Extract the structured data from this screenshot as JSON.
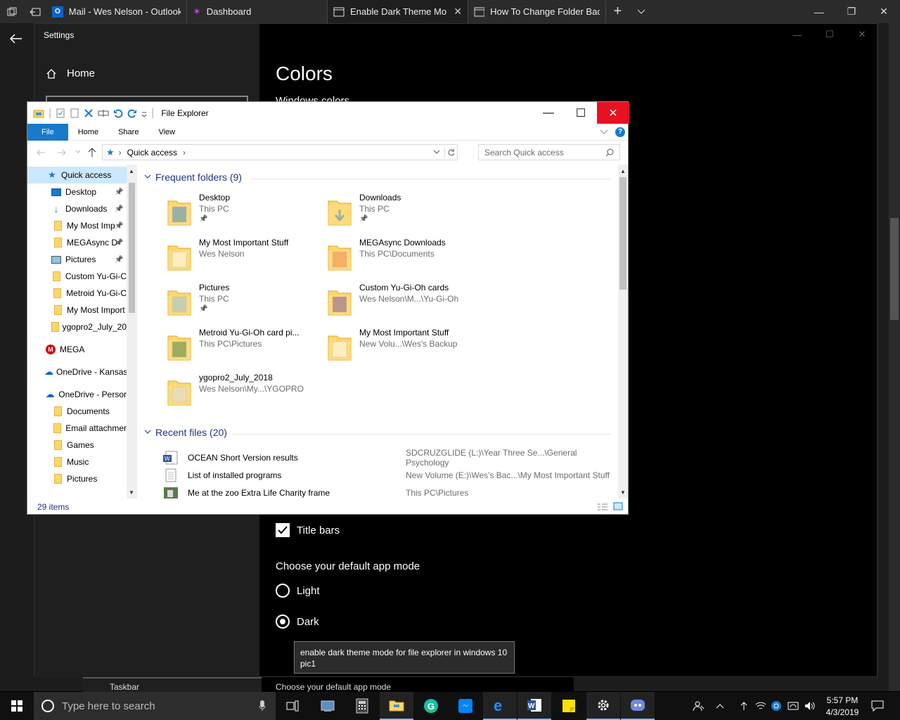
{
  "browser": {
    "tabs": [
      {
        "title": "Mail - Wes Nelson - Outlook"
      },
      {
        "title": "Dashboard"
      },
      {
        "title": "Enable Dark Theme Mo"
      },
      {
        "title": "How To Change Folder Back"
      }
    ]
  },
  "settings": {
    "window_title": "Settings",
    "home_label": "Home",
    "heading": "Colors",
    "subheading": "Windows colors",
    "title_bars_label": "Title bars",
    "app_mode_label": "Choose your default app mode",
    "light_label": "Light",
    "dark_label": "Dark",
    "selected_mode": "Dark",
    "tooltip": "enable dark theme mode for file explorer in windows 10 pic1"
  },
  "peek": {
    "taskbar_label": "Taskbar",
    "mode_label": "Choose your default app mode"
  },
  "explorer": {
    "title": "File Explorer",
    "ribbon_tabs": [
      "File",
      "Home",
      "Share",
      "View"
    ],
    "address": "Quick access",
    "search_placeholder": "Search Quick access",
    "status": "29 items",
    "nav": [
      {
        "label": "Quick access",
        "pinned": false
      },
      {
        "label": "Desktop",
        "pinned": true
      },
      {
        "label": "Downloads",
        "pinned": true
      },
      {
        "label": "My Most Imp",
        "pinned": true
      },
      {
        "label": "MEGAsync D",
        "pinned": true
      },
      {
        "label": "Pictures",
        "pinned": true
      },
      {
        "label": "Custom Yu-Gi-C",
        "pinned": false
      },
      {
        "label": "Metroid Yu-Gi-C",
        "pinned": false
      },
      {
        "label": "My Most Import",
        "pinned": false
      },
      {
        "label": "ygopro2_July_20",
        "pinned": false
      },
      {
        "label": "MEGA",
        "pinned": false
      },
      {
        "label": "OneDrive - Kansas",
        "pinned": false
      },
      {
        "label": "OneDrive - Persor",
        "pinned": false
      },
      {
        "label": "Documents",
        "pinned": false
      },
      {
        "label": "Email attachmer",
        "pinned": false
      },
      {
        "label": "Games",
        "pinned": false
      },
      {
        "label": "Music",
        "pinned": false
      },
      {
        "label": "Pictures",
        "pinned": false
      }
    ],
    "frequent_header": "Frequent folders (9)",
    "recent_header": "Recent files (20)",
    "frequent": [
      {
        "name": "Desktop",
        "location": "This PC",
        "pinned": true
      },
      {
        "name": "Downloads",
        "location": "This PC",
        "pinned": true
      },
      {
        "name": "My Most Important Stuff",
        "location": "Wes Nelson",
        "pinned": false
      },
      {
        "name": "MEGAsync Downloads",
        "location": "This PC\\Documents",
        "pinned": false
      },
      {
        "name": "Pictures",
        "location": "This PC",
        "pinned": true
      },
      {
        "name": "Custom Yu-Gi-Oh cards",
        "location": "Wes Nelson\\M...\\Yu-Gi-Oh",
        "pinned": false
      },
      {
        "name": "Metroid Yu-Gi-Oh card pi...",
        "location": "This PC\\Pictures",
        "pinned": false
      },
      {
        "name": "My Most Important Stuff",
        "location": "New Volu...\\Wes's Backup",
        "pinned": false
      },
      {
        "name": "ygopro2_July_2018",
        "location": "Wes Nelson\\My...\\YGOPRO",
        "pinned": false
      }
    ],
    "recent": [
      {
        "name": "OCEAN Short Version results",
        "path": "SDCRUZGLIDE (L:)\\Year Three Se...\\General Psychology"
      },
      {
        "name": "List of installed programs",
        "path": "New Volume (E:)\\Wes's Bac...\\My Most Important Stuff"
      },
      {
        "name": "Me at the zoo Extra Life Charity frame",
        "path": "This PC\\Pictures"
      }
    ]
  },
  "taskbar": {
    "search_placeholder": "Type here to search",
    "time": "5:57 PM",
    "date": "4/3/2019"
  }
}
